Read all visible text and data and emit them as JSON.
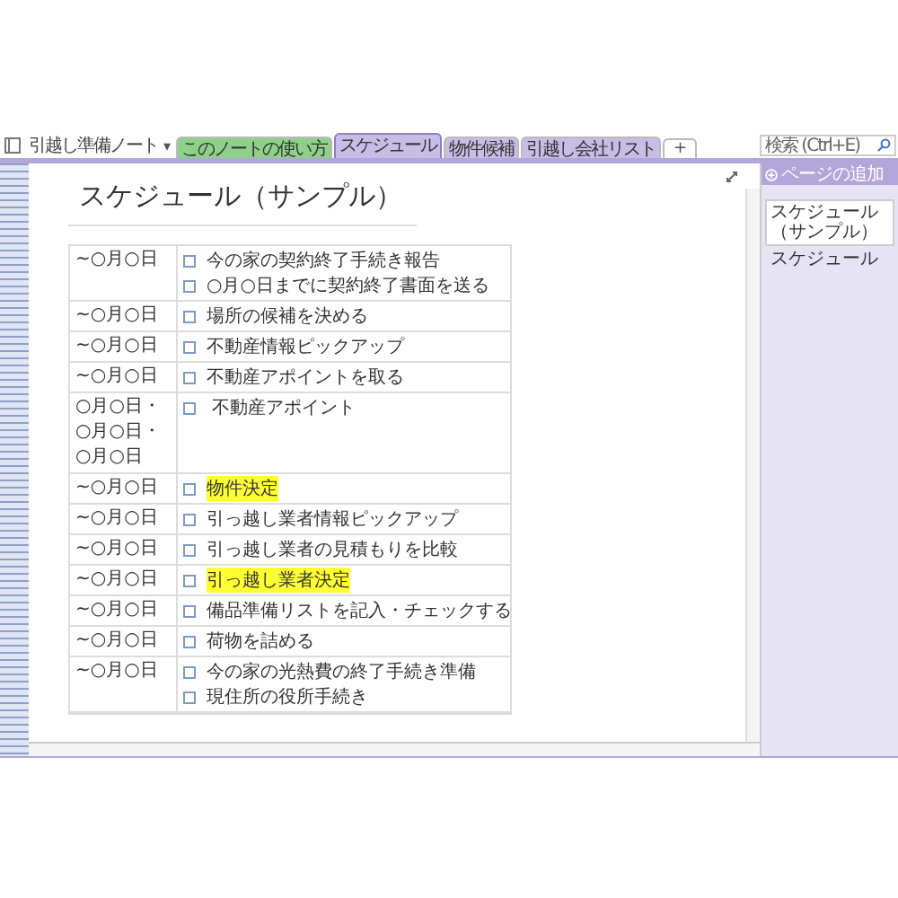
{
  "notebook": {
    "title": "引越し準備ノート",
    "caret": "▾"
  },
  "section_tabs": [
    {
      "label": "このノートの使い方",
      "color": "#8fd18a",
      "selected": false
    },
    {
      "label": "スケジュール",
      "color": "#c8bde6",
      "selected": true
    },
    {
      "label": "物件候補",
      "color": "#c8bde6",
      "selected": false
    },
    {
      "label": "引越し会社リスト",
      "color": "#c8bde6",
      "selected": false
    }
  ],
  "add_tab": "+",
  "search": {
    "placeholder": "検索 (Ctrl+E)"
  },
  "page": {
    "title": "スケジュール（サンプル）"
  },
  "rows": [
    {
      "date": [
        "~○月○日"
      ],
      "tasks": [
        {
          "text": "今の家の契約終了手続き報告",
          "checked": false,
          "highlighted": false
        },
        {
          "text": "○月○日までに契約終了書面を送る",
          "checked": false,
          "highlighted": false
        }
      ]
    },
    {
      "date": [
        "~○月○日"
      ],
      "tasks": [
        {
          "text": "場所の候補を決める",
          "checked": false,
          "highlighted": false
        }
      ]
    },
    {
      "date": [
        "~○月○日"
      ],
      "tasks": [
        {
          "text": "不動産情報ピックアップ",
          "checked": false,
          "highlighted": false
        }
      ]
    },
    {
      "date": [
        "~○月○日"
      ],
      "tasks": [
        {
          "text": "不動産アポイントを取る",
          "checked": false,
          "highlighted": false
        }
      ]
    },
    {
      "date": [
        "○月○日・",
        "○月○日・",
        "○月○日"
      ],
      "tasks": [
        {
          "text": " 不動産アポイント",
          "checked": false,
          "highlighted": false
        }
      ]
    },
    {
      "date": [
        "~○月○日"
      ],
      "tasks": [
        {
          "text": "物件決定",
          "checked": false,
          "highlighted": true
        }
      ]
    },
    {
      "date": [
        "~○月○日"
      ],
      "tasks": [
        {
          "text": "引っ越し業者情報ピックアップ",
          "checked": false,
          "highlighted": false
        }
      ]
    },
    {
      "date": [
        "~○月○日"
      ],
      "tasks": [
        {
          "text": "引っ越し業者の見積もりを比較",
          "checked": false,
          "highlighted": false
        }
      ]
    },
    {
      "date": [
        "~○月○日"
      ],
      "tasks": [
        {
          "text": "引っ越し業者決定",
          "checked": false,
          "highlighted": true
        }
      ]
    },
    {
      "date": [
        "~○月○日"
      ],
      "tasks": [
        {
          "text": "備品準備リストを記入・チェックする",
          "checked": false,
          "highlighted": false
        }
      ]
    },
    {
      "date": [
        "~○月○日"
      ],
      "tasks": [
        {
          "text": "荷物を詰める",
          "checked": false,
          "highlighted": false
        }
      ]
    },
    {
      "date": [
        "~○月○日"
      ],
      "tasks": [
        {
          "text": "今の家の光熱費の終了手続き準備",
          "checked": false,
          "highlighted": false
        },
        {
          "text": "現住所の役所手続き",
          "checked": false,
          "highlighted": false
        }
      ]
    }
  ],
  "pages_panel": {
    "add_page": "ページの追加",
    "pages": [
      {
        "label": "スケジュール（サンプル）",
        "selected": true
      },
      {
        "label": "スケジュール",
        "selected": false
      }
    ]
  }
}
